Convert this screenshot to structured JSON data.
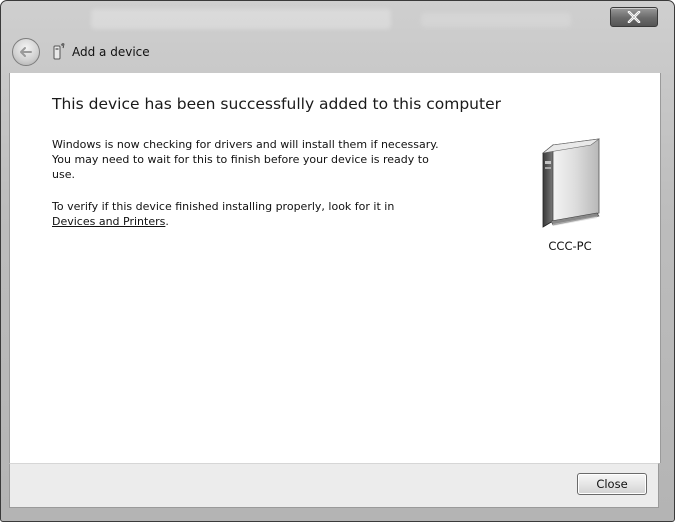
{
  "window": {
    "title": "Add a device"
  },
  "main": {
    "heading": "This device has been successfully added to this computer",
    "para1": "Windows is now checking for drivers and will install them if necessary. You may need to wait for this to finish before your device is ready to use.",
    "para2_text": "To verify if this device finished installing properly, look for it in",
    "para2_link": "Devices and Printers",
    "para2_suffix": "."
  },
  "device": {
    "label": "CCC-PC",
    "icon": "computer-tower-icon"
  },
  "footer": {
    "close_label": "Close"
  },
  "icons": {
    "back": "back-arrow-icon",
    "nav_device": "device-icon",
    "window_close": "close-icon"
  }
}
